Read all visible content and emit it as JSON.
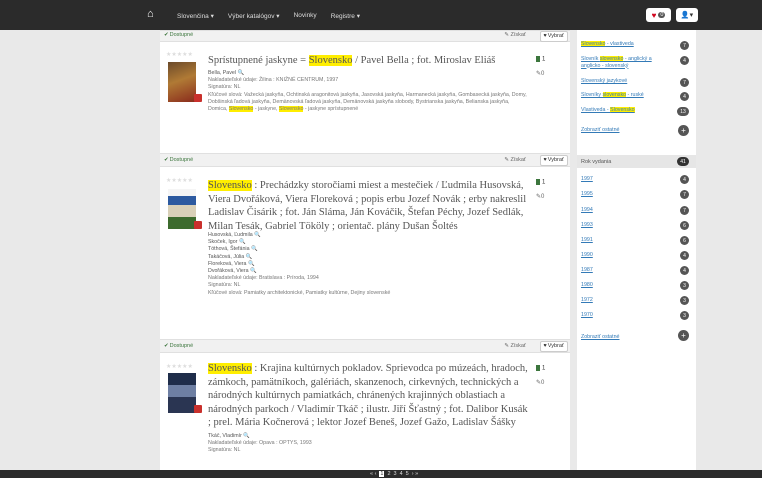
{
  "nav": {
    "menu": [
      "Slovenčina ▾",
      "Výber katalógov ▾",
      "Novinky",
      "Registre ▾"
    ],
    "fav_count": "0"
  },
  "labels": {
    "available": "Dostupné",
    "get": "Získať",
    "select": "Vybrať"
  },
  "records": [
    {
      "title_pre": "Sprístupnené jaskyne = ",
      "title_hl": "Slovensko",
      "title_post": " / Pavel Bella ; fot. Miroslav Eliáš",
      "author": "Bella, Pavel",
      "publisher": "Nakladateľské údaje: Žilina : KNIŽNÉ CENTRUM, 1997",
      "signature": "Signatúra: NL",
      "keywords_pre": "Kľúčové slová: Važecká jaskyňa, Ochtinská aragonitová jaskyňa, Jasovská jaskyňa, Harmanecká jaskyňa, Gombasecká jaskyňa, Domy, Dobšinská ľadová jaskyňa, Demänovská ľadová jaskyňa, Demänovská jaskyňa slobody, Bystrianska jaskyňa, Belianska jaskyňa, Domica, ",
      "keywords_hl1": "Slovensko",
      "keywords_mid": " - jaskyne, ",
      "keywords_hl2": "Slovensko",
      "keywords_post": " - jaskyne sprístupnené",
      "count1": "1",
      "count2": "0"
    },
    {
      "title_hl": "Slovensko",
      "title_post": " : Prechádzky storočiami miest a mestečiek / Ľudmila Husovská, Viera Dvořáková, Viera Floreková ; popis erbu Jozef Novák ; erby nakreslil Ladislav Čisárik ; fot. Ján Sláma, Ján Kováčik, Štefan Péchy, Jozef Sedlák, Milan Tesák, Gabriel Tököly ; orientač. plány Dušan Šoltés",
      "authors": [
        "Husovská, Ľudmila",
        "Skoček, Igor",
        "Tóthová, Štefánia",
        "Takáčová, Júlia",
        "Floreková, Viera",
        "Dvořáková, Viera"
      ],
      "publisher": "Nakladateľské údaje: Bratislava : Príroda, 1994",
      "signature": "Signatúra: NL",
      "keywords": "Kľúčové slová: Pamiatky architektonické, Pamiatky kultúrne, Dejiny slovenské",
      "count1": "1",
      "count2": "0"
    },
    {
      "title_hl": "Slovensko",
      "title_post": " : Krajina kultúrnych pokladov. Sprievodca po múzeách, hradoch, zámkoch, pamätníkoch, galériách, skanzenoch, cirkevných, technických a národných kultúrnych pamiatkách, chránených krajinných oblastiach a národných parkoch / Vladimír Tkáč ; ilustr. Jiří Šťastný ; fot. Dalibor Kusák ; prel. Mária Kočnerová ; lektor Jozef Beneš, Jozef Gažo, Ladislav Šášky",
      "author": "Tkáč, Vladimír",
      "publisher": "Nakladateľské údaje: Opava : OPTYS, 1993",
      "signature": "Signatúra: NL",
      "count1": "1",
      "count2": "0"
    }
  ],
  "sidebar": {
    "top_facets": [
      {
        "pre": "",
        "hl": "Slovensko",
        "post": " - vlastiveda",
        "count": "7"
      },
      {
        "pre": "Slovník ",
        "hl": "slovensko",
        "post": " - anglický a anglicko - slovenský",
        "count": "4"
      },
      {
        "pre": "",
        "hl": "",
        "post": "Slovenský jazykové",
        "count": "7"
      },
      {
        "pre": "Slovníky ",
        "hl": "slovensko",
        "post": " - ruské",
        "count": "4"
      },
      {
        "pre": "Vlastiveda - ",
        "hl": "Slovensko",
        "post": "",
        "count": "13"
      }
    ],
    "show_more": "Zobraziť ostatné",
    "year_heading": "Rok vydania",
    "year_total": "41",
    "years": [
      {
        "year": "1997",
        "count": "4"
      },
      {
        "year": "1995",
        "count": "7"
      },
      {
        "year": "1994",
        "count": "7"
      },
      {
        "year": "1993",
        "count": "6"
      },
      {
        "year": "1991",
        "count": "6"
      },
      {
        "year": "1990",
        "count": "4"
      },
      {
        "year": "1987",
        "count": "4"
      },
      {
        "year": "1980",
        "count": "3"
      },
      {
        "year": "1972",
        "count": "3"
      },
      {
        "year": "1970",
        "count": "3"
      }
    ]
  },
  "pager": {
    "prev": "« ‹",
    "pages": [
      "1",
      "2",
      "3",
      "4",
      "5"
    ],
    "next": "› »"
  }
}
